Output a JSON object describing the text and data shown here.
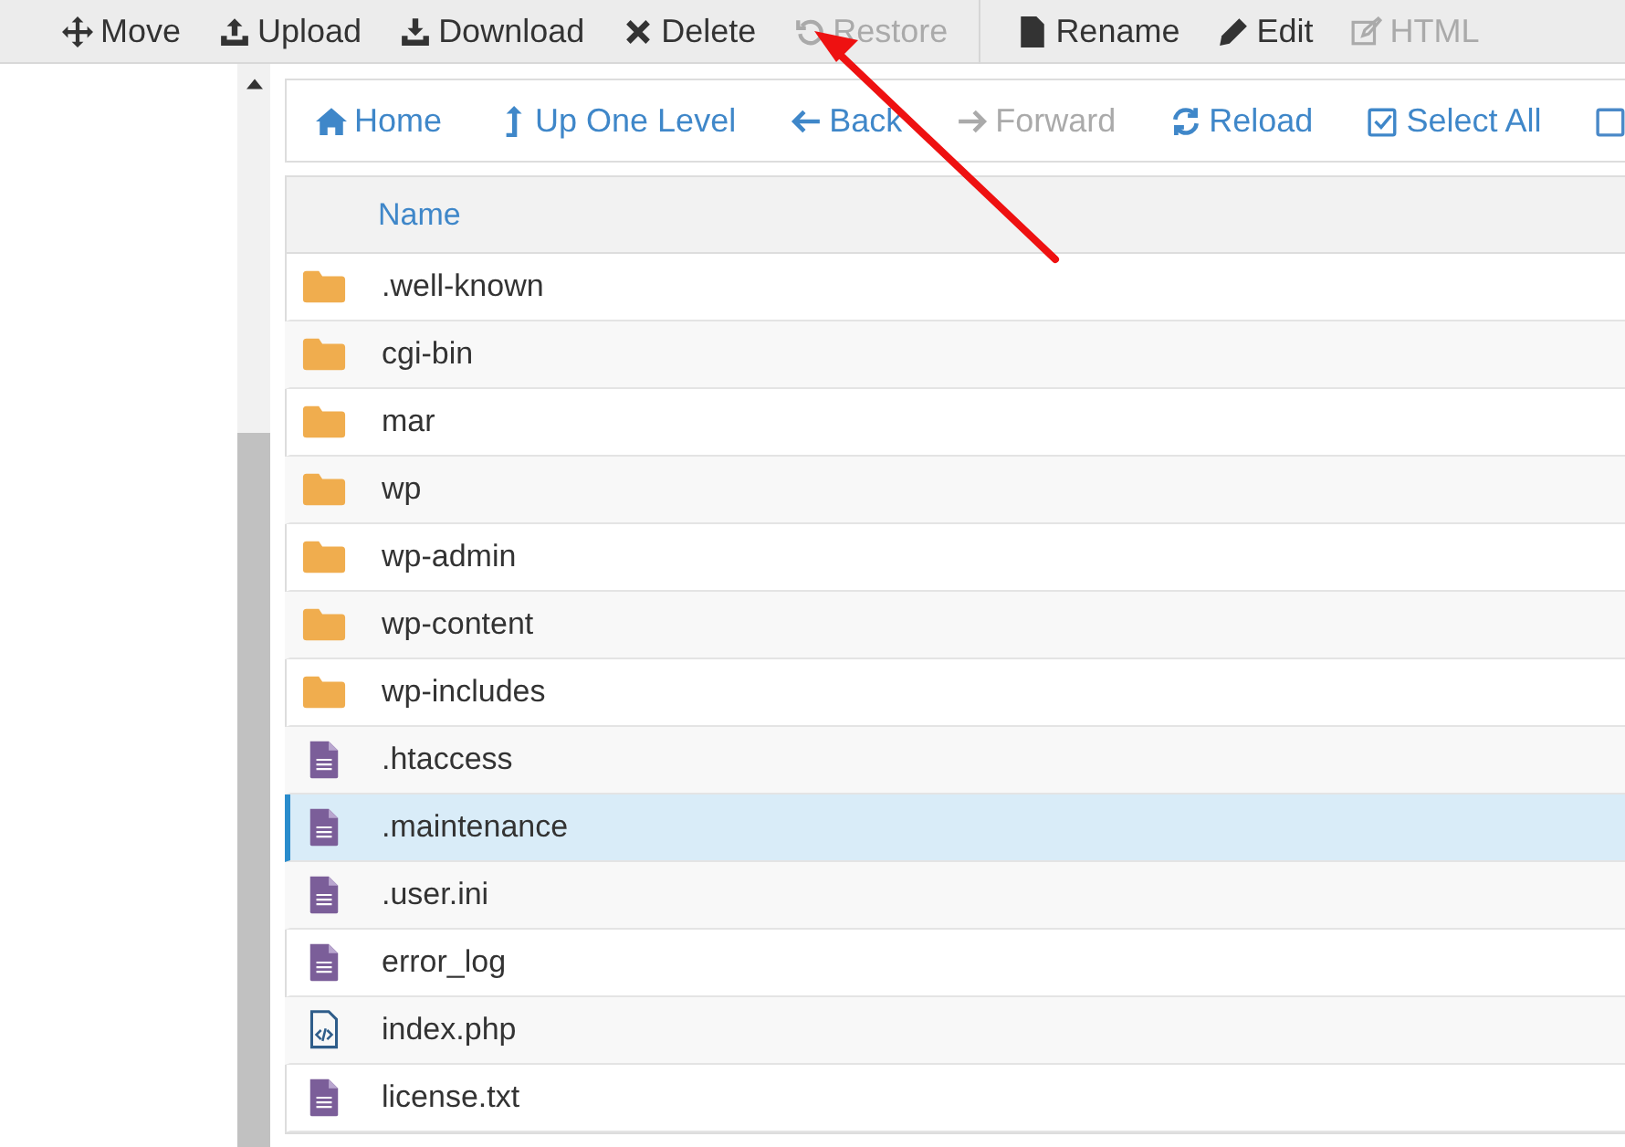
{
  "toolbar": [
    {
      "label": "Move",
      "disabled": false
    },
    {
      "label": "Upload",
      "disabled": false
    },
    {
      "label": "Download",
      "disabled": false
    },
    {
      "label": "Delete",
      "disabled": false
    },
    {
      "label": "Restore",
      "disabled": true
    },
    {
      "label": "Rename",
      "disabled": false
    },
    {
      "label": "Edit",
      "disabled": false
    },
    {
      "label": "HTML",
      "disabled": true
    }
  ],
  "nav": [
    {
      "label": "Home",
      "disabled": false
    },
    {
      "label": "Up One Level",
      "disabled": false
    },
    {
      "label": "Back",
      "disabled": false
    },
    {
      "label": "Forward",
      "disabled": true
    },
    {
      "label": "Reload",
      "disabled": false
    },
    {
      "label": "Select All",
      "disabled": false
    }
  ],
  "table": {
    "columns": [
      "Name"
    ],
    "rows": [
      {
        "name": ".well-known",
        "kind": "folder",
        "selected": false
      },
      {
        "name": "cgi-bin",
        "kind": "folder",
        "selected": false
      },
      {
        "name": "mar",
        "kind": "folder",
        "selected": false
      },
      {
        "name": "wp",
        "kind": "folder",
        "selected": false
      },
      {
        "name": "wp-admin",
        "kind": "folder",
        "selected": false
      },
      {
        "name": "wp-content",
        "kind": "folder",
        "selected": false
      },
      {
        "name": "wp-includes",
        "kind": "folder",
        "selected": false
      },
      {
        "name": ".htaccess",
        "kind": "text",
        "selected": false
      },
      {
        "name": ".maintenance",
        "kind": "text",
        "selected": true
      },
      {
        "name": ".user.ini",
        "kind": "text",
        "selected": false
      },
      {
        "name": "error_log",
        "kind": "text",
        "selected": false
      },
      {
        "name": "index.php",
        "kind": "code",
        "selected": false
      },
      {
        "name": "license.txt",
        "kind": "text",
        "selected": false
      }
    ]
  }
}
